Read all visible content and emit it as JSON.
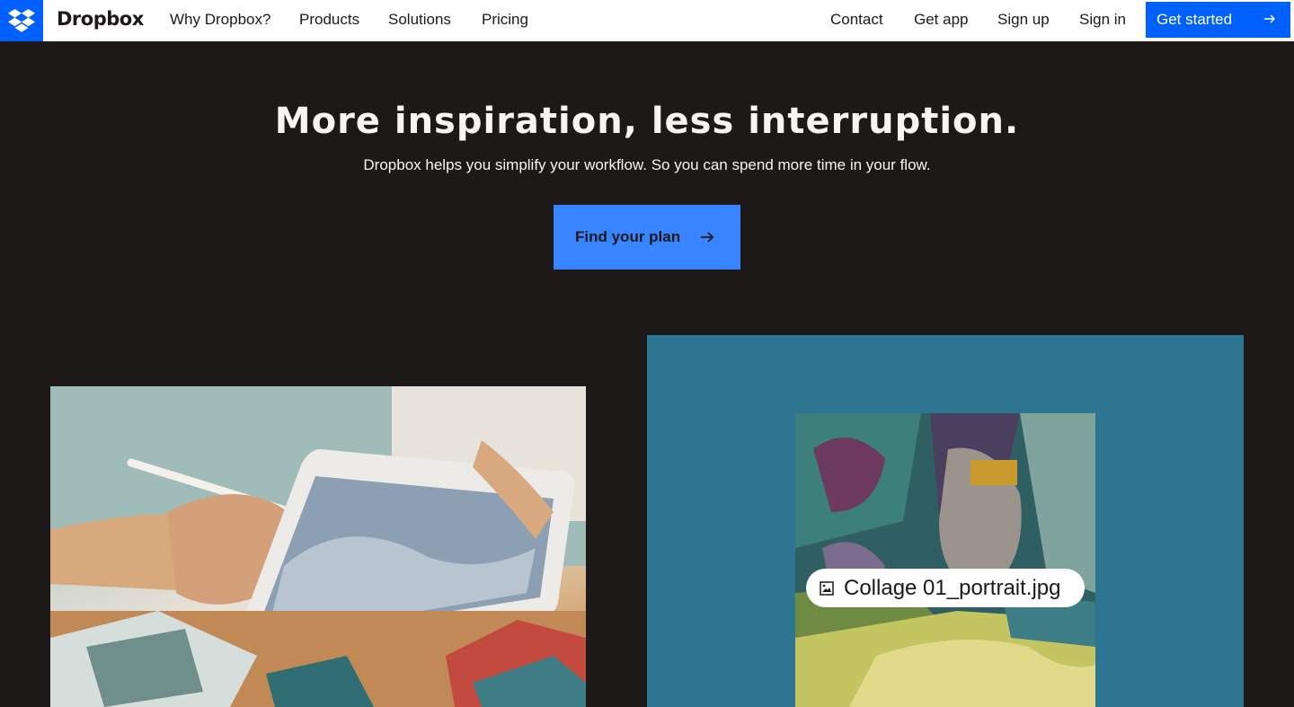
{
  "nav": {
    "brand": "Dropbox",
    "links": [
      "Why Dropbox?",
      "Products",
      "Solutions",
      "Pricing"
    ],
    "right_links": [
      "Contact",
      "Get app",
      "Sign up",
      "Sign in"
    ],
    "cta_label": "Get started"
  },
  "hero": {
    "title": "More inspiration, less interruption.",
    "subtitle": "Dropbox helps you simplify your workflow. So you can spend more time in your flow.",
    "button_label": "Find your plan"
  },
  "media": {
    "file_name": "Collage 01_portrait.jpg"
  },
  "colors": {
    "brand_blue": "#0061fe",
    "button_blue": "#3984ff",
    "page_background": "#1e1919",
    "panel_teal": "#2e7592"
  }
}
